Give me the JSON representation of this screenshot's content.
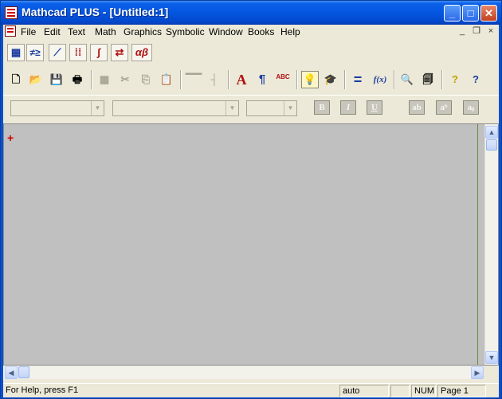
{
  "window": {
    "title": "Mathcad PLUS - [Untitled:1]",
    "controls": {
      "minimize": "_",
      "maximize": "□",
      "close": "✕"
    }
  },
  "menubar": {
    "items": [
      "File",
      "Edit",
      "Text",
      "Math",
      "Graphics",
      "Symbolic",
      "Window",
      "Books",
      "Help"
    ],
    "doc_controls": {
      "minimize": "_",
      "restore": "❐",
      "close": "×"
    }
  },
  "palette_toolbar": {
    "tools": [
      "calculator-palette-icon",
      "evaluation-palette-icon",
      "graph-palette-icon",
      "matrix-palette-icon",
      "calculus-palette-icon",
      "programming-palette-icon",
      "greek-palette-icon"
    ],
    "greek_label": "αβ"
  },
  "standard_toolbar": {
    "glyphs": {
      "new": "🗋",
      "open": "📂",
      "save": "💾",
      "print": "🖶",
      "cut": "✂",
      "copy": "⎘",
      "paste": "📋",
      "text": "A",
      "paragraph": "¶",
      "spell": "ABC",
      "calc_mode": "💡",
      "resources": "🎓",
      "equals": "=",
      "function": "f(x)",
      "zoom": "🔍",
      "insert_unit": "🗐",
      "help_wizard": "?",
      "help": "?"
    }
  },
  "format_toolbar": {
    "style_value": "",
    "font_value": "",
    "size_value": "",
    "bold": "B",
    "italic": "I",
    "underline": "U",
    "ab": "ab",
    "superscript": "aᵇ",
    "subscript": "aᵦ"
  },
  "worksheet": {
    "cursor": "+"
  },
  "statusbar": {
    "help_text": "For Help, press F1",
    "mode": "auto",
    "num": "NUM",
    "page": "Page 1"
  }
}
